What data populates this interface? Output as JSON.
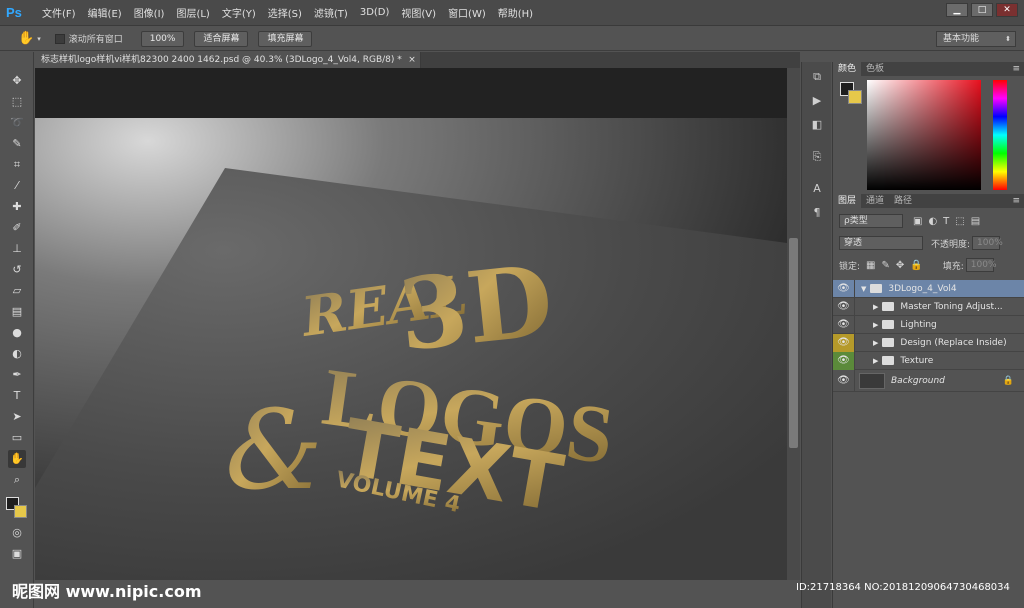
{
  "app": {
    "logo": "Ps"
  },
  "menu": [
    "文件(F)",
    "编辑(E)",
    "图像(I)",
    "图层(L)",
    "文字(Y)",
    "选择(S)",
    "滤镜(T)",
    "3D(D)",
    "视图(V)",
    "窗口(W)",
    "帮助(H)"
  ],
  "window_controls": {
    "minimize": "▁",
    "restore": "□",
    "close": "✕"
  },
  "options": {
    "scroll_all_label": "滚动所有窗口",
    "zoom_100": "100%",
    "fit_screen": "适合屏幕",
    "fill_screen": "填充屏幕",
    "workspace": "基本功能"
  },
  "document": {
    "tab_title": "标志样机logo样机vi样机82300 2400 1462.psd @ 40.3% (3DLogo_4_Vol4, RGB/8) *",
    "close": "×"
  },
  "artwork": {
    "line1": "REAL",
    "line2": "3D",
    "line3": "LOGOS",
    "amp": "&",
    "line4": "TEXT",
    "line5": "VOLUME 4"
  },
  "color_panel": {
    "tabs": [
      "颜色",
      "色板"
    ]
  },
  "layers_panel": {
    "tabs": [
      "图层",
      "通道",
      "路径"
    ],
    "filter": "ρ类型",
    "blend_mode": "穿透",
    "opacity_label": "不透明度:",
    "opacity_value": "100%",
    "lock_label": "锁定:",
    "fill_label": "填充:",
    "fill_value": "100%",
    "layers": [
      {
        "name": "3DLogo_4_Vol4",
        "type": "group",
        "selected": true
      },
      {
        "name": "Master Toning Adjust...",
        "type": "group"
      },
      {
        "name": "Lighting",
        "type": "group"
      },
      {
        "name": "Design (Replace Inside)",
        "type": "group",
        "eye_color": "#b59a2a"
      },
      {
        "name": "Texture",
        "type": "group",
        "eye_color": "#5b8a3a"
      },
      {
        "name": "Background",
        "type": "background"
      }
    ]
  },
  "watermark": {
    "site": "昵图网 www.nipic.com",
    "id": "ID:21718364 NO:20181209064730468034"
  }
}
